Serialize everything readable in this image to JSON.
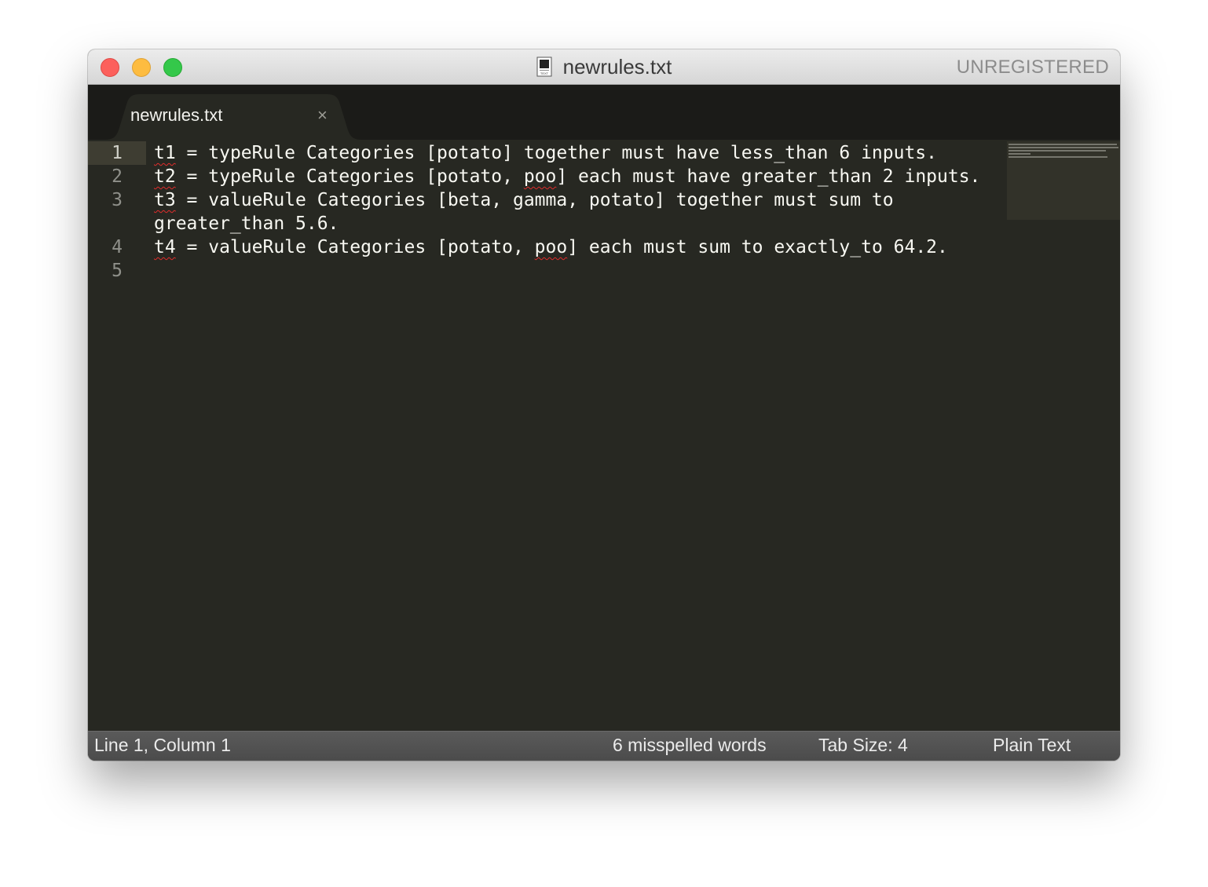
{
  "window": {
    "title": "newrules.txt",
    "registration": "UNREGISTERED",
    "file_icon_label": "TEXT"
  },
  "tabs": [
    {
      "label": "newrules.txt",
      "close_glyph": "×",
      "active": true
    }
  ],
  "editor": {
    "active_line": 1,
    "lines": [
      {
        "number": "1",
        "prefix": "t1",
        "rest": " = typeRule Categories [potato] together must have less_than 6 inputs."
      },
      {
        "number": "2",
        "prefix": "t2",
        "mid": " = typeRule Categories [potato, ",
        "misspelled": "poo",
        "rest": "] each must have greater_than 2 inputs."
      },
      {
        "number": "3",
        "prefix": "t3",
        "rest": " = valueRule Categories [beta, gamma, potato] together must sum to",
        "wrap": "greater_than 5.6."
      },
      {
        "number": "4",
        "prefix": "t4",
        "mid": " = valueRule Categories [potato, ",
        "misspelled": "poo",
        "rest": "] each must sum to exactly_to 64.2."
      },
      {
        "number": "5",
        "prefix": "",
        "rest": ""
      }
    ],
    "misspelling_color": "#e02c2c",
    "background": "#272822",
    "foreground": "#f8f8f2"
  },
  "status": {
    "position": "Line 1, Column 1",
    "spelling": "6 misspelled words",
    "tab_size": "Tab Size: 4",
    "syntax": "Plain Text"
  },
  "icons": {
    "close": "close-icon",
    "file": "text-file-icon"
  }
}
